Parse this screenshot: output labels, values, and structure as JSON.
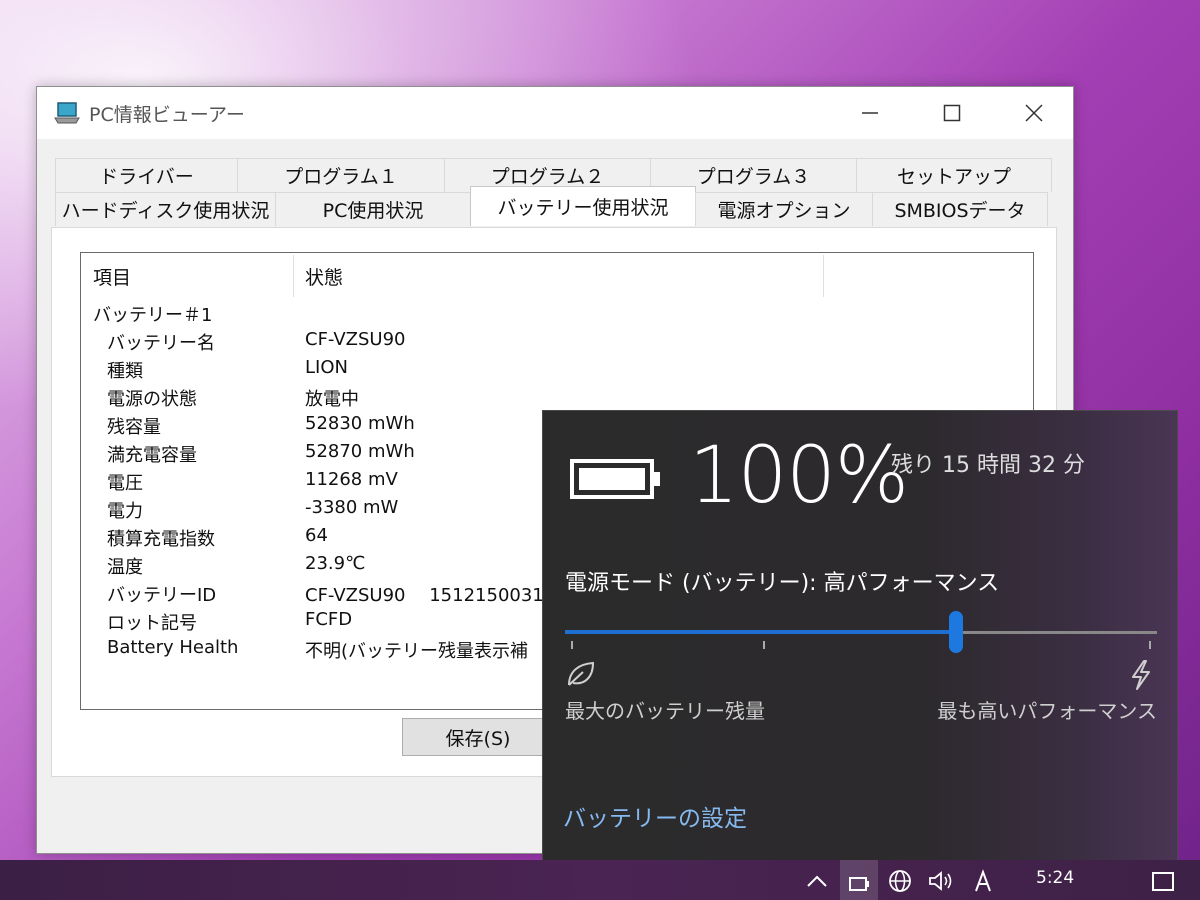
{
  "window": {
    "title": "PC情報ビューアー"
  },
  "tabs": {
    "row1": [
      "ドライバー",
      "プログラム１",
      "プログラム２",
      "プログラム３",
      "セットアップ"
    ],
    "row2": [
      "ハードディスク使用状況",
      "PC使用状況",
      "バッテリー使用状況",
      "電源オプション",
      "SMBIOSデータ"
    ],
    "active": "バッテリー使用状況"
  },
  "list": {
    "columns": [
      "項目",
      "状態"
    ],
    "group": "バッテリー＃1",
    "rows": [
      {
        "key": "バッテリー名",
        "value": "CF-VZSU90"
      },
      {
        "key": "種類",
        "value": "LION"
      },
      {
        "key": "電源の状態",
        "value": "放電中"
      },
      {
        "key": "残容量",
        "value": "52830 mWh"
      },
      {
        "key": "満充電容量",
        "value": "52870 mWh"
      },
      {
        "key": "電圧",
        "value": "11268 mV"
      },
      {
        "key": "電力",
        "value": "-3380 mW"
      },
      {
        "key": "積算充電指数",
        "value": "64"
      },
      {
        "key": "温度",
        "value": "23.9℃"
      },
      {
        "key": "バッテリーID",
        "value": "CF-VZSU90　 1512150031"
      },
      {
        "key": "ロット記号",
        "value": "FCFD"
      },
      {
        "key": "Battery Health",
        "value": "不明(バッテリー残量表示補"
      }
    ]
  },
  "buttons": {
    "save": "保存(S)"
  },
  "flyout": {
    "percent": "100%",
    "remaining": "残り 15 時間 32 分",
    "mode_label": "電源モード (バッテリー): 高パフォーマンス",
    "slider_level": 0.66,
    "min_label": "最大のバッテリー残量",
    "max_label": "最も高いパフォーマンス",
    "settings_link": "バッテリーの設定"
  },
  "taskbar": {
    "clock": "5:24"
  },
  "colors": {
    "accent": "#1d78e0",
    "link": "#86b9f0"
  }
}
